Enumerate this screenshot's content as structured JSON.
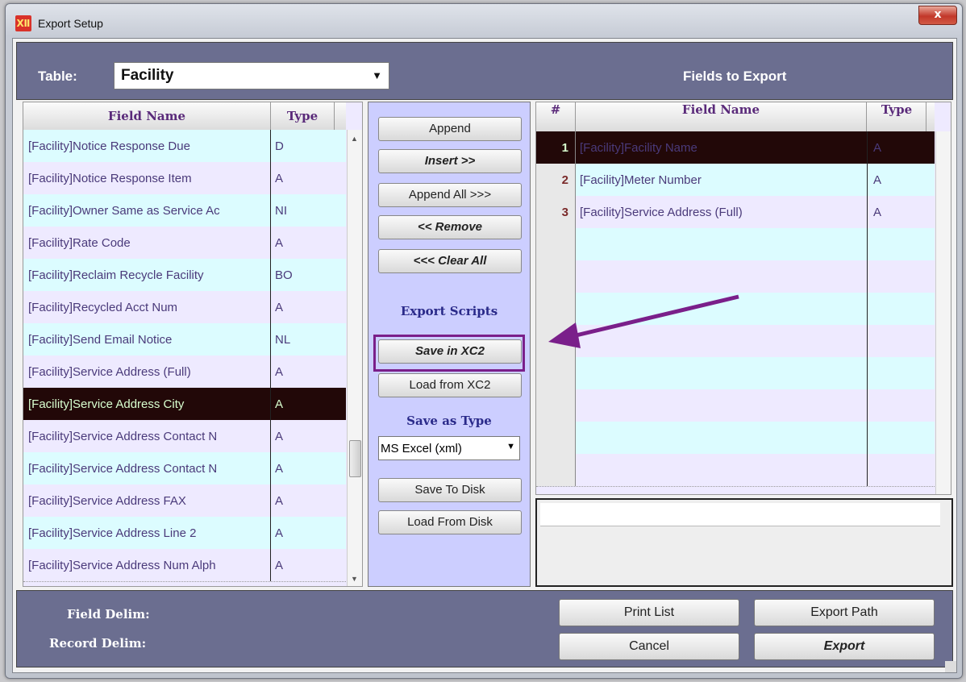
{
  "window": {
    "title": "Export Setup",
    "close_label": "x",
    "app_icon": "app-logo-icon"
  },
  "table_selector": {
    "label": "Table:",
    "value": "Facility"
  },
  "fields_to_export_title": "Fields to Export",
  "left_table": {
    "headers": {
      "field_name": "Field Name",
      "type": "Type"
    },
    "rows": [
      {
        "name": "[Facility]Notice Response Due",
        "type": "D"
      },
      {
        "name": "[Facility]Notice Response Item",
        "type": "A"
      },
      {
        "name": "[Facility]Owner Same as Service Ac",
        "type": "NI"
      },
      {
        "name": "[Facility]Rate Code",
        "type": "A"
      },
      {
        "name": "[Facility]Reclaim Recycle Facility",
        "type": "BO"
      },
      {
        "name": "[Facility]Recycled Acct Num",
        "type": "A"
      },
      {
        "name": "[Facility]Send Email Notice",
        "type": "NL"
      },
      {
        "name": "[Facility]Service Address (Full)",
        "type": "A"
      },
      {
        "name": "[Facility]Service Address City",
        "type": "A",
        "selected": true
      },
      {
        "name": "[Facility]Service Address Contact N",
        "type": "A"
      },
      {
        "name": "[Facility]Service Address Contact N",
        "type": "A"
      },
      {
        "name": "[Facility]Service Address FAX",
        "type": "A"
      },
      {
        "name": "[Facility]Service Address Line 2",
        "type": "A"
      },
      {
        "name": "[Facility]Service Address Num Alph",
        "type": "A"
      }
    ]
  },
  "middle": {
    "append": "Append",
    "insert": "Insert >>",
    "append_all": "Append All >>>",
    "remove": "<< Remove",
    "clear_all": "<<< Clear All",
    "export_scripts": "Export Scripts",
    "save_xc2": "Save in XC2",
    "load_xc2": "Load from XC2",
    "save_as_type": "Save as Type",
    "type_value": "MS Excel (xml)",
    "save_disk": "Save To Disk",
    "load_disk": "Load From Disk"
  },
  "right_table": {
    "headers": {
      "num": "#",
      "field_name": "Field Name",
      "type": "Type"
    },
    "rows": [
      {
        "num": "1",
        "name": "[Facility]Facility Name",
        "type": "A",
        "selected": true
      },
      {
        "num": "2",
        "name": "[Facility]Meter Number",
        "type": "A"
      },
      {
        "num": "3",
        "name": "[Facility]Service Address (Full)",
        "type": "A"
      },
      {
        "num": "",
        "name": "",
        "type": ""
      },
      {
        "num": "",
        "name": "",
        "type": ""
      },
      {
        "num": "",
        "name": "",
        "type": ""
      },
      {
        "num": "",
        "name": "",
        "type": ""
      },
      {
        "num": "",
        "name": "",
        "type": ""
      },
      {
        "num": "",
        "name": "",
        "type": ""
      },
      {
        "num": "",
        "name": "",
        "type": ""
      },
      {
        "num": "",
        "name": "",
        "type": ""
      }
    ]
  },
  "bottom": {
    "field_delim": "Field Delim:",
    "record_delim": "Record Delim:",
    "print_list": "Print List",
    "export_path": "Export Path",
    "cancel": "Cancel",
    "export": "Export"
  },
  "colors": {
    "highlight_box": "#7a1f8a",
    "arrow": "#7a1f8a",
    "selected_row": "#220808"
  }
}
